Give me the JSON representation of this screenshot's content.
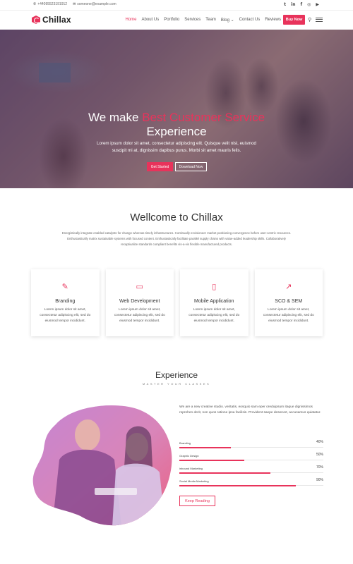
{
  "topbar": {
    "phone": "+44095523191912",
    "email": "someone@example.com",
    "social": [
      "twitter-icon",
      "linkedin-icon",
      "facebook-icon",
      "instagram-icon",
      "youtube-icon"
    ]
  },
  "nav": {
    "logo_text": "Chillax",
    "items": [
      {
        "label": "Home",
        "active": true
      },
      {
        "label": "About Us"
      },
      {
        "label": "Portfolio"
      },
      {
        "label": "Services"
      },
      {
        "label": "Team"
      },
      {
        "label": "Blog ⌄"
      },
      {
        "label": "Contact Us"
      },
      {
        "label": "Reviews"
      }
    ],
    "buy_label": "Buy Now"
  },
  "hero": {
    "title_prefix": "We make ",
    "title_highlight": "Best Customer Service",
    "title_line2": "Experience",
    "subtitle": "Lorem ipsum dolor sit amet, consectetur adipiscing elit. Quisque velit nisl, euismod suscipit mi at, dignissim dapibus purus. Morbi sit amet mauris felis.",
    "btn_primary": "Get Started",
    "btn_secondary": "Download Now"
  },
  "welcome": {
    "title": "Wellcome to Chillax",
    "text": "Energistically integrate enabled catalysts for change whereas timely infrastructures. Continually envisioneer market positioning convergence before user-centric resources. Enthusiastically matrix sustainable systems with focused content. Enthusiastically facilitate parallel supply chains with value-added leadership skills. Collaboratively recaptiualize standards compliant benefits vis-a-vis flexible manufactured products."
  },
  "services": [
    {
      "icon": "brush-icon",
      "title": "Branding",
      "text": "Lorem ipsum dolor sit amet, consectetur adipiscing elit, sed do eiusmod tempor incididunt."
    },
    {
      "icon": "monitor-icon",
      "title": "Web Development",
      "text": "Lorem ipsum dolor sit amet, consectetur adipiscing elit, sed do eiusmod tempor incididunt."
    },
    {
      "icon": "mobile-icon",
      "title": "Mobile Application",
      "text": "Lorem ipsum dolor sit amet, consectetur adipiscing elit, sed do eiusmod tempor incididunt."
    },
    {
      "icon": "trend-icon",
      "title": "SCO & SEM",
      "text": "Lorem ipsum dolor sit amet, consectetur adipiscing elit, sed do eiusmod tempor incididunt."
    }
  ],
  "experience": {
    "title": "Experience",
    "subtitle": "MASTER YOUR CLASSES",
    "text": "We are a new creative studio. veritatis, eosquio sam eper oreduipsum itaque dignissimos reprehen derit, non quos ratione ipsa facilisis. Provident saepe deserunt, accusamus quiatatur.",
    "skills": [
      {
        "label": "Branding",
        "percent": "40%",
        "value": 40
      },
      {
        "label": "Graphic Design",
        "percent": "50%",
        "value": 50
      },
      {
        "label": "inbound Marketing",
        "percent": "70%",
        "value": 70
      },
      {
        "label": "Social Media Marketing",
        "percent": "90%",
        "value": 90
      }
    ],
    "button": "Keep Reading"
  },
  "colors": {
    "accent": "#e8335b"
  }
}
